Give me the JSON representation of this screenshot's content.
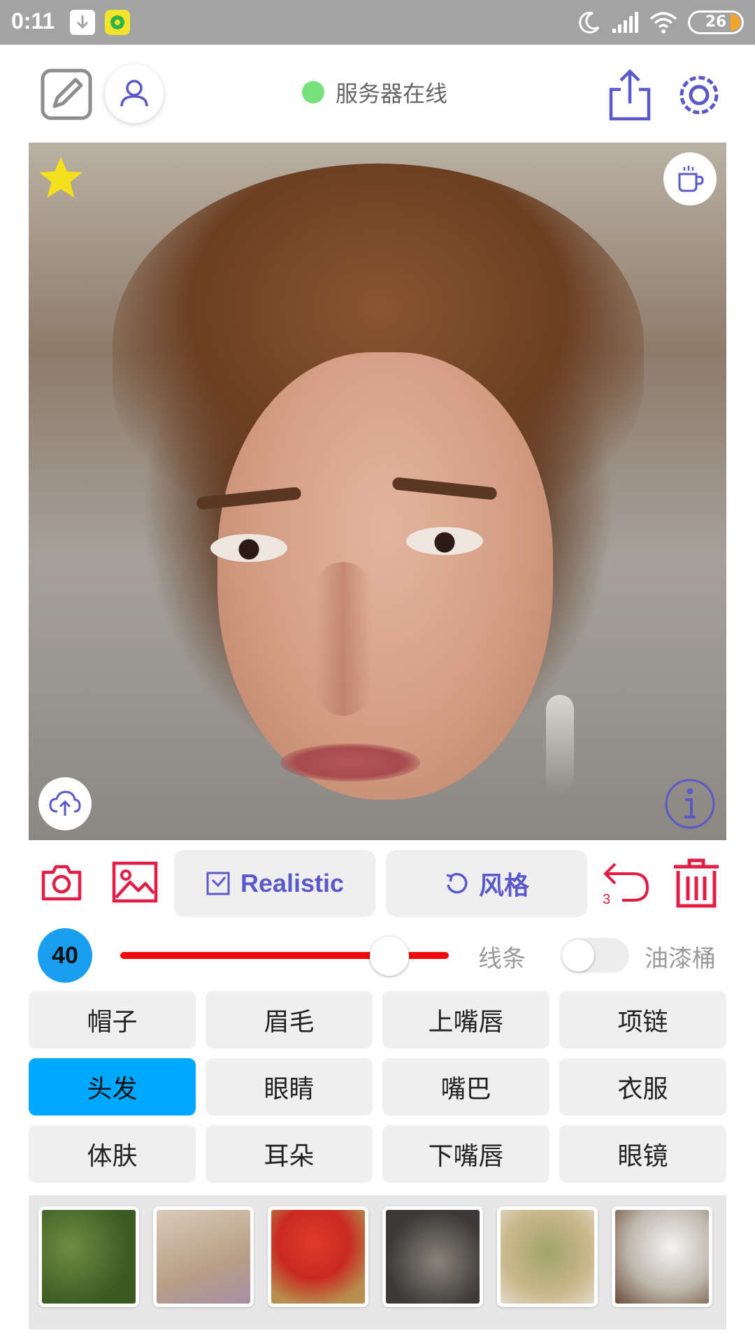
{
  "status_bar": {
    "time": "0:11",
    "battery": "26",
    "icons": [
      "download-icon",
      "music-app-icon",
      "moon-icon",
      "signal-icon",
      "wifi-icon",
      "battery-icon"
    ]
  },
  "header": {
    "server_status": "服务器在线",
    "server_status_color": "#76e07a"
  },
  "toolbar": {
    "realistic_label": "Realistic",
    "style_label": "风格",
    "undo_count": "3"
  },
  "brush": {
    "size": "40",
    "slider_level_percent": 82,
    "line_label": "线条",
    "bucket_label": "油漆桶",
    "bucket_enabled": false
  },
  "categories": [
    {
      "label": "帽子",
      "active": false
    },
    {
      "label": "眉毛",
      "active": false
    },
    {
      "label": "上嘴唇",
      "active": false
    },
    {
      "label": "项链",
      "active": false
    },
    {
      "label": "头发",
      "active": true
    },
    {
      "label": "眼睛",
      "active": false
    },
    {
      "label": "嘴巴",
      "active": false
    },
    {
      "label": "衣服",
      "active": false
    },
    {
      "label": "体肤",
      "active": false
    },
    {
      "label": "耳朵",
      "active": false
    },
    {
      "label": "下嘴唇",
      "active": false
    },
    {
      "label": "眼镜",
      "active": false
    }
  ],
  "colors": {
    "accent": "#5b58c9",
    "danger": "#e11c45",
    "active_category": "#00a8ff",
    "brush_line": "#ee0b0b",
    "favorite_star": "#f4e01d"
  }
}
